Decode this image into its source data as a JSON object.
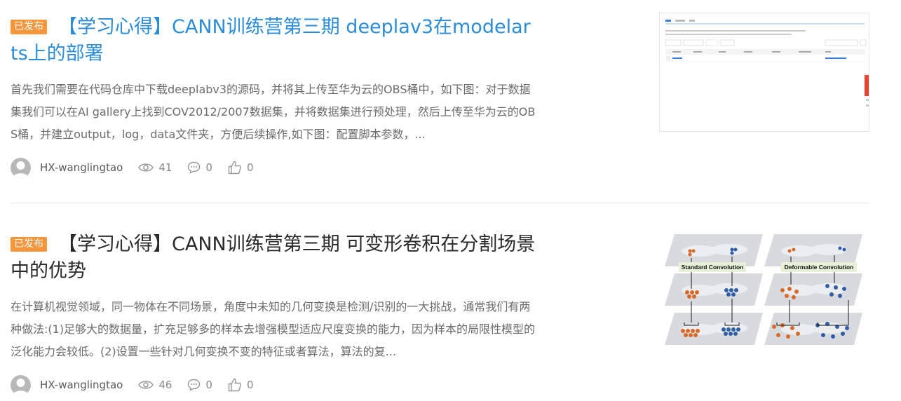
{
  "articles": [
    {
      "badge": "已发布",
      "title": "【学习心得】CANN训练营第三期 deeplav3在modelarts上的部署",
      "summary": "首先我们需要在代码仓库中下载deeplabv3的源码，并将其上传至华为云的OBS桶中，如下图：对于数据集我们可以在AI gallery上找到COV2012/2007数据集，并将数据集进行预处理，然后上传至华为云的OBS桶，并建立output，log，data文件夹，方便后续操作,如下图：配置脚本参数，...",
      "author": "HX-wanglingtao",
      "views": "41",
      "comments": "0",
      "likes": "0"
    },
    {
      "badge": "已发布",
      "title": "【学习心得】CANN训练营第三期 可变形卷积在分割场景中的优势",
      "summary": "在计算机视觉领域，同一物体在不同场景，角度中未知的几何变换是检测/识别的一大挑战，通常我们有两种做法:(1)足够大的数据量，扩充足够多的样本去增强模型适应尺度变换的能力，因为样本的局限性模型的泛化能力会较低。(2)设置一些针对几何变换不变的特征或者算法，算法的复...",
      "author": "HX-wanglingtao",
      "views": "46",
      "comments": "0",
      "likes": "0",
      "thumb_labels": {
        "left": "Standard Convolution",
        "right": "Deformable Convolution"
      }
    }
  ],
  "colors": {
    "badge": "#f6963c",
    "title_link": "#2d8cd8",
    "title_dark": "#2a2a2a",
    "summary": "#6b6b6b"
  },
  "icons": {
    "views": "eye-icon",
    "comments": "comment-icon",
    "likes": "thumbs-up-icon",
    "avatar": "user-avatar-icon"
  }
}
